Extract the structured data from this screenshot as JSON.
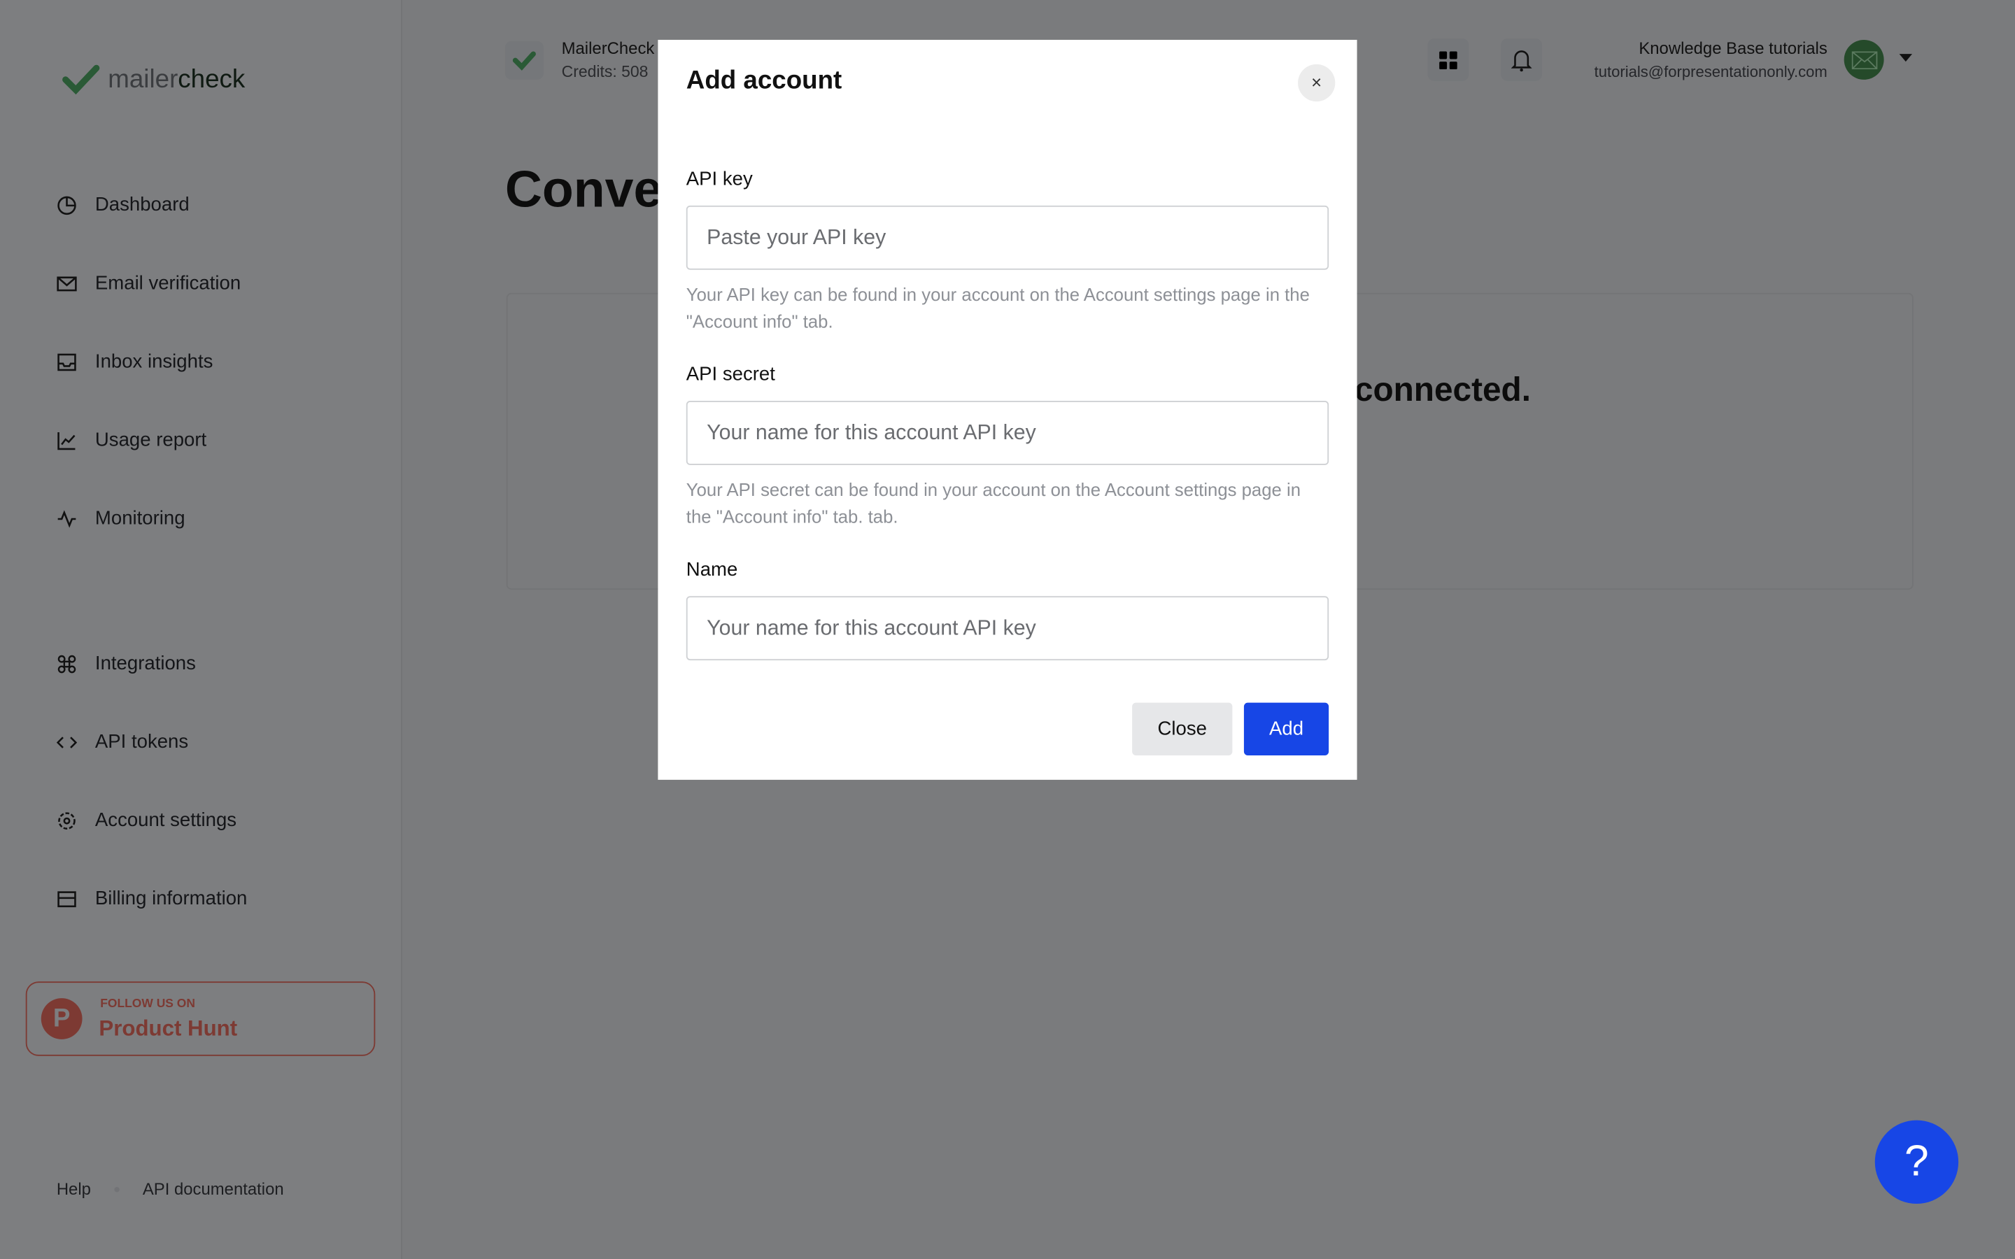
{
  "sidebar": {
    "brand": {
      "part1": "mailer",
      "part2": "check"
    },
    "items": [
      {
        "label": "Dashboard",
        "icon": "pie-chart-icon"
      },
      {
        "label": "Email verification",
        "icon": "mail-check-icon"
      },
      {
        "label": "Inbox insights",
        "icon": "inbox-icon"
      },
      {
        "label": "Usage report",
        "icon": "line-chart-icon"
      },
      {
        "label": "Monitoring",
        "icon": "activity-icon"
      },
      {
        "label": "Integrations",
        "icon": "command-icon"
      },
      {
        "label": "API tokens",
        "icon": "code-icon"
      },
      {
        "label": "Account settings",
        "icon": "gear-icon"
      },
      {
        "label": "Billing information",
        "icon": "credit-card-icon"
      }
    ],
    "product_hunt": {
      "follow": "FOLLOW US ON",
      "name": "Product Hunt",
      "letter": "P"
    },
    "footer": {
      "help": "Help",
      "api_docs": "API documentation"
    }
  },
  "header": {
    "account_name": "MailerCheck",
    "credits": "Credits: 508",
    "user_name": "Knowledge Base tutorials",
    "user_email": "tutorials@forpresentationonly.com"
  },
  "page": {
    "title": "Conve",
    "card_text": "connected."
  },
  "modal": {
    "title": "Add account",
    "close_icon": "×",
    "fields": [
      {
        "label": "API key",
        "placeholder": "Paste your API key",
        "hint": "Your API key can be found in your account on the Account settings page in the \"Account info\" tab."
      },
      {
        "label": "API secret",
        "placeholder": "Your name for this account API key",
        "hint": "Your API secret can be found in your account on the Account settings page in the \"Account info\" tab. tab."
      },
      {
        "label": "Name",
        "placeholder": "Your name for this account API key"
      }
    ],
    "close_label": "Close",
    "add_label": "Add"
  },
  "help_button": "?",
  "colors": {
    "accent": "#1746e6",
    "brand_green": "#2e8b57",
    "product_hunt": "#da552f"
  }
}
